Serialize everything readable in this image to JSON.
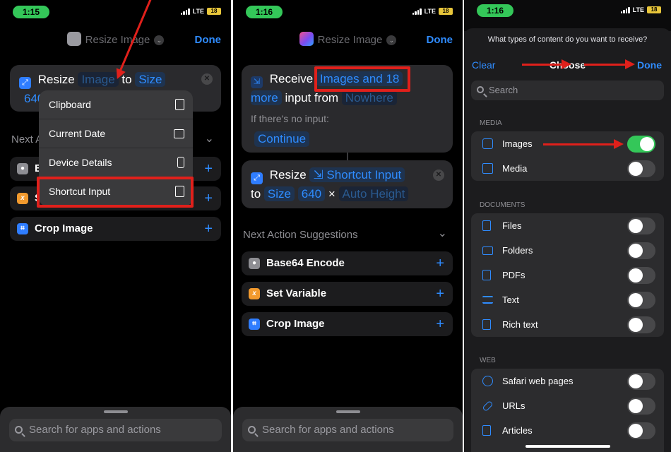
{
  "colors": {
    "accent": "#2f8cff",
    "toggle_on": "#34c759",
    "highlight": "#e0201b",
    "time_pill": "#34c759"
  },
  "status": {
    "time1": "1:15",
    "time2": "1:16",
    "time3": "1:16",
    "network": "LTE",
    "battery": "18"
  },
  "panel1": {
    "header": {
      "title": "Resize Image",
      "done": "Done"
    },
    "action": {
      "verb": "Resize",
      "token": "Image",
      "to": "to",
      "size": "Size",
      "width": "640"
    },
    "menu": [
      {
        "label": "Clipboard",
        "icon": "clipboard-icon"
      },
      {
        "label": "Current Date",
        "icon": "calendar-icon"
      },
      {
        "label": "Device Details",
        "icon": "phone-icon"
      },
      {
        "label": "Shortcut Input",
        "icon": "shortcut-input-icon"
      }
    ],
    "next_head": "Next A",
    "rows": [
      {
        "label": "B"
      },
      {
        "label": "S"
      },
      {
        "label": "Crop Image"
      }
    ],
    "search_placeholder": "Search for apps and actions"
  },
  "panel2": {
    "header": {
      "title": "Resize Image",
      "done": "Done"
    },
    "receive": {
      "verb": "Receive",
      "token": "Images and 18",
      "token_more": "more",
      "input_from": "input from",
      "source": "Nowhere",
      "no_input": "If there's no input:",
      "continue": "Continue"
    },
    "resize": {
      "verb": "Resize",
      "token": "Shortcut Input",
      "to": "to",
      "size": "Size",
      "width": "640",
      "times": "×",
      "height": "Auto Height"
    },
    "next_head": "Next Action Suggestions",
    "suggestions": [
      {
        "label": "Base64 Encode",
        "icon": "base64-icon"
      },
      {
        "label": "Set Variable",
        "icon": "variable-icon"
      },
      {
        "label": "Crop Image",
        "icon": "crop-icon"
      }
    ],
    "search_placeholder": "Search for apps and actions"
  },
  "panel3": {
    "question": "What types of content do you want to receive?",
    "clear": "Clear",
    "choose": "Choose",
    "done": "Done",
    "search_placeholder": "Search",
    "sections": [
      {
        "title": "MEDIA",
        "items": [
          {
            "label": "Images",
            "on": true,
            "icon": "photo-icon"
          },
          {
            "label": "Media",
            "on": false,
            "icon": "media-icon"
          }
        ]
      },
      {
        "title": "DOCUMENTS",
        "items": [
          {
            "label": "Files",
            "on": false,
            "icon": "file-icon"
          },
          {
            "label": "Folders",
            "on": false,
            "icon": "folder-icon"
          },
          {
            "label": "PDFs",
            "on": false,
            "icon": "pdf-icon"
          },
          {
            "label": "Text",
            "on": false,
            "icon": "text-icon"
          },
          {
            "label": "Rich text",
            "on": false,
            "icon": "rich-text-icon"
          }
        ]
      },
      {
        "title": "WEB",
        "items": [
          {
            "label": "Safari web pages",
            "on": false,
            "icon": "safari-icon"
          },
          {
            "label": "URLs",
            "on": false,
            "icon": "link-icon"
          },
          {
            "label": "Articles",
            "on": false,
            "icon": "article-icon"
          }
        ]
      }
    ]
  }
}
